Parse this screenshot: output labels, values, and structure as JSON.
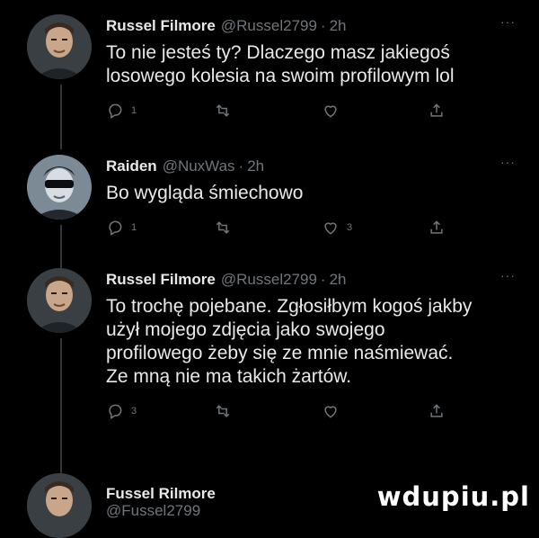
{
  "tweets": [
    {
      "name": "Russel Filmore",
      "handle": "@Russel2799",
      "time": "2h",
      "more": "···",
      "text": "To nie jesteś ty? Dlaczego masz jakiegoś\nlosowego kolesia na swoim profilowym lol",
      "reply_count": "1",
      "retweet_count": "",
      "like_count": "",
      "avatar_icon": "man-avatar-icon"
    },
    {
      "name": "Raiden",
      "handle": "@NuxWas",
      "time": "2h",
      "more": "···",
      "text": "Bo wygląda śmiechowo",
      "reply_count": "1",
      "retweet_count": "",
      "like_count": "3",
      "avatar_icon": "sunglasses-avatar-icon"
    },
    {
      "name": "Russel Filmore",
      "handle": "@Russel2799",
      "time": "2h",
      "more": "···",
      "text": "To trochę pojebane. Zgłosiłbym kogoś jakby\nużył mojego zdjęcia jako swojego\nprofilowego żeby się ze mnie naśmiewać.\nZe mną nie ma takich żartów.",
      "reply_count": "3",
      "retweet_count": "",
      "like_count": "",
      "avatar_icon": "man-avatar-icon"
    },
    {
      "name": "Fussel Rilmore",
      "handle": "@Fussel2799",
      "avatar_icon": "man-avatar-icon"
    }
  ],
  "watermark": "wdupiu.pl",
  "colors": {
    "background": "#000000",
    "text": "#e7e9ea",
    "muted": "#71767b",
    "thread_line": "#333639"
  }
}
